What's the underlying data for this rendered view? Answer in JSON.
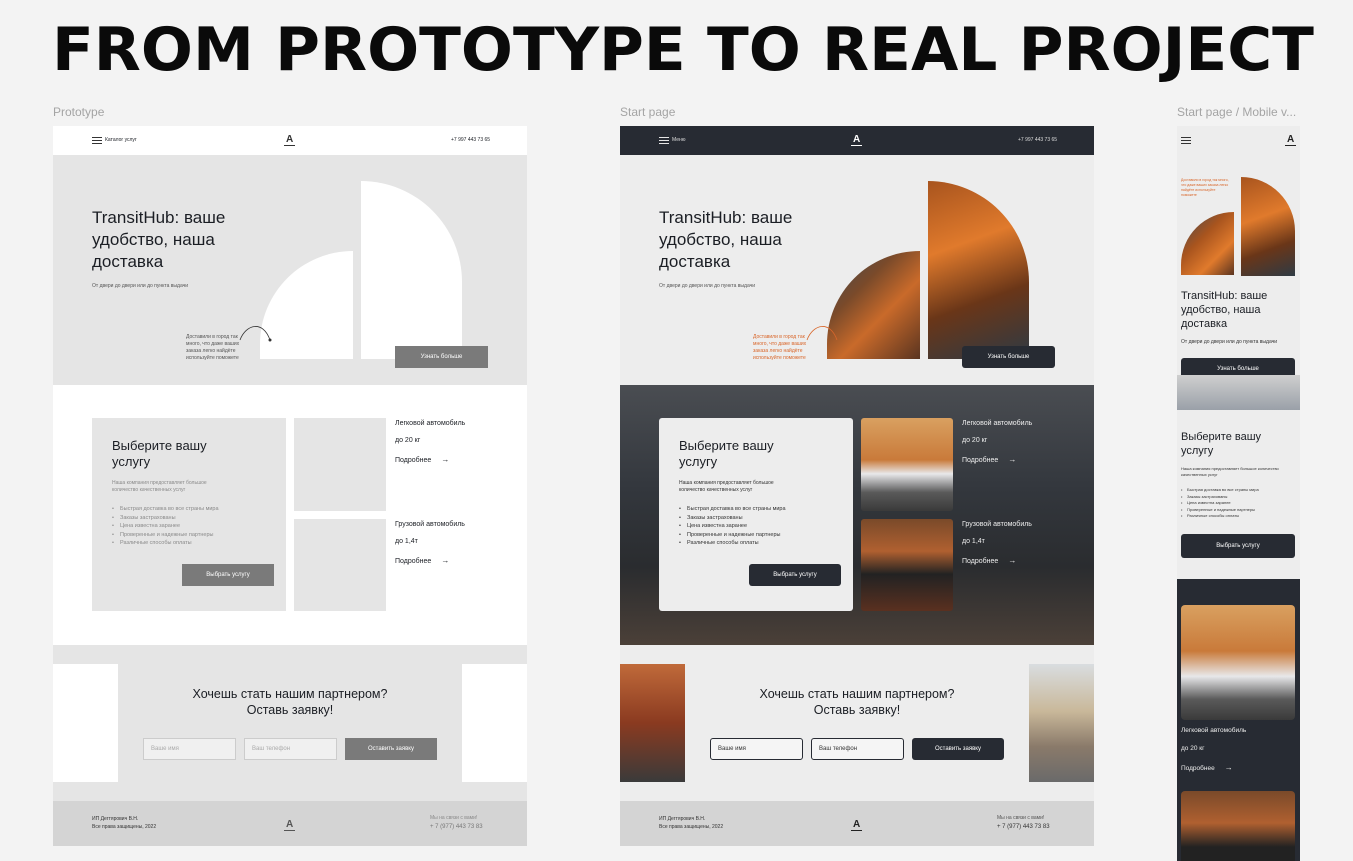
{
  "headline": "FROM PROTOTYPE TO REAL PROJECT",
  "frames": {
    "prototype_label": "Prototype",
    "start_label": "Start page",
    "mobile_label": "Start page / Mobile v..."
  },
  "nav": {
    "proto_menu": "Каталог услуг",
    "start_menu": "Меню",
    "phone": "+7 997 443 73 65",
    "logo": "A"
  },
  "hero": {
    "title": "TransitHub: ваше удобство, наша доставка",
    "subtitle": "От двери до двери или до пункта выдачи",
    "note": "Доставили в город так много, что даже ваших заказа легко найдёте используйте поможете",
    "cta": "Узнать больше"
  },
  "services": {
    "title": "Выберите вашу услугу",
    "description": "Наша компания предоставляет большое количество качественных услуг",
    "features": [
      "Быстрая доставка во все страны мира",
      "Заказы застрахованы",
      "Цена известна заранее",
      "Проверенные и надежные партнеры",
      "Различные способы оплаты"
    ],
    "cta": "Выбрать услугу",
    "more": "Подробнее",
    "items": [
      {
        "name": "Легковой автомобиль",
        "capacity": "до 20 кг"
      },
      {
        "name": "Грузовой автомобиль",
        "capacity": "до 1,4т"
      }
    ]
  },
  "partner": {
    "title": "Хочешь стать нашим партнером? Оставь заявку!",
    "name_placeholder": "Ваше имя",
    "phone_placeholder": "Ваш телефон",
    "submit": "Оставить заявку"
  },
  "footer": {
    "company": "ИП Дегтярович В.Н.",
    "rights": "Все права защищены, 2022",
    "contact_label": "Мы на связи с вами!",
    "phone": "+ 7 (977) 443 73 83"
  },
  "colors": {
    "dark": "#272b33",
    "accent": "#d9662a",
    "wire_gray": "#e5e5e5",
    "wire_button": "#7a7a7a"
  }
}
